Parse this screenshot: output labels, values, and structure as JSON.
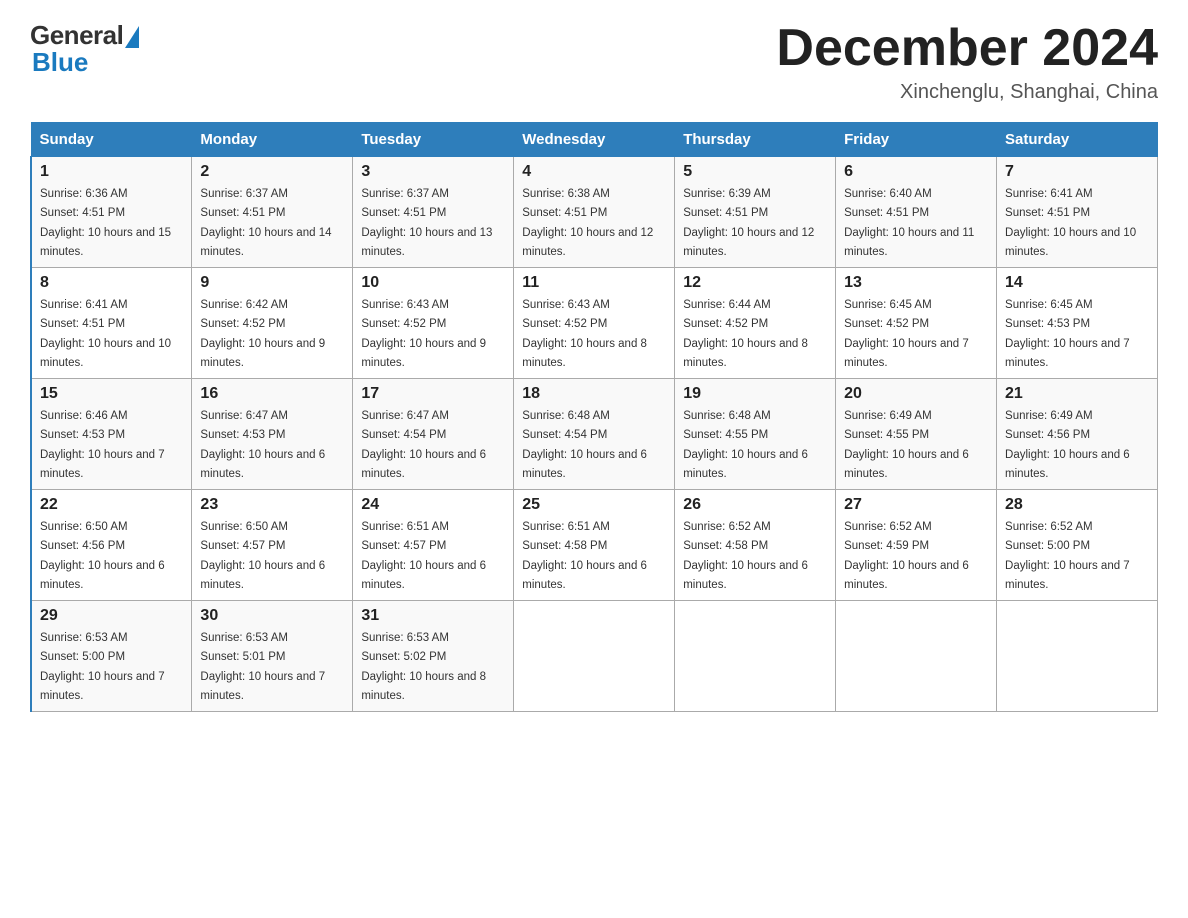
{
  "logo": {
    "general": "General",
    "blue": "Blue"
  },
  "title": "December 2024",
  "location": "Xinchenglu, Shanghai, China",
  "days_of_week": [
    "Sunday",
    "Monday",
    "Tuesday",
    "Wednesday",
    "Thursday",
    "Friday",
    "Saturday"
  ],
  "weeks": [
    [
      {
        "day": "1",
        "sunrise": "6:36 AM",
        "sunset": "4:51 PM",
        "daylight": "10 hours and 15 minutes."
      },
      {
        "day": "2",
        "sunrise": "6:37 AM",
        "sunset": "4:51 PM",
        "daylight": "10 hours and 14 minutes."
      },
      {
        "day": "3",
        "sunrise": "6:37 AM",
        "sunset": "4:51 PM",
        "daylight": "10 hours and 13 minutes."
      },
      {
        "day": "4",
        "sunrise": "6:38 AM",
        "sunset": "4:51 PM",
        "daylight": "10 hours and 12 minutes."
      },
      {
        "day": "5",
        "sunrise": "6:39 AM",
        "sunset": "4:51 PM",
        "daylight": "10 hours and 12 minutes."
      },
      {
        "day": "6",
        "sunrise": "6:40 AM",
        "sunset": "4:51 PM",
        "daylight": "10 hours and 11 minutes."
      },
      {
        "day": "7",
        "sunrise": "6:41 AM",
        "sunset": "4:51 PM",
        "daylight": "10 hours and 10 minutes."
      }
    ],
    [
      {
        "day": "8",
        "sunrise": "6:41 AM",
        "sunset": "4:51 PM",
        "daylight": "10 hours and 10 minutes."
      },
      {
        "day": "9",
        "sunrise": "6:42 AM",
        "sunset": "4:52 PM",
        "daylight": "10 hours and 9 minutes."
      },
      {
        "day": "10",
        "sunrise": "6:43 AM",
        "sunset": "4:52 PM",
        "daylight": "10 hours and 9 minutes."
      },
      {
        "day": "11",
        "sunrise": "6:43 AM",
        "sunset": "4:52 PM",
        "daylight": "10 hours and 8 minutes."
      },
      {
        "day": "12",
        "sunrise": "6:44 AM",
        "sunset": "4:52 PM",
        "daylight": "10 hours and 8 minutes."
      },
      {
        "day": "13",
        "sunrise": "6:45 AM",
        "sunset": "4:52 PM",
        "daylight": "10 hours and 7 minutes."
      },
      {
        "day": "14",
        "sunrise": "6:45 AM",
        "sunset": "4:53 PM",
        "daylight": "10 hours and 7 minutes."
      }
    ],
    [
      {
        "day": "15",
        "sunrise": "6:46 AM",
        "sunset": "4:53 PM",
        "daylight": "10 hours and 7 minutes."
      },
      {
        "day": "16",
        "sunrise": "6:47 AM",
        "sunset": "4:53 PM",
        "daylight": "10 hours and 6 minutes."
      },
      {
        "day": "17",
        "sunrise": "6:47 AM",
        "sunset": "4:54 PM",
        "daylight": "10 hours and 6 minutes."
      },
      {
        "day": "18",
        "sunrise": "6:48 AM",
        "sunset": "4:54 PM",
        "daylight": "10 hours and 6 minutes."
      },
      {
        "day": "19",
        "sunrise": "6:48 AM",
        "sunset": "4:55 PM",
        "daylight": "10 hours and 6 minutes."
      },
      {
        "day": "20",
        "sunrise": "6:49 AM",
        "sunset": "4:55 PM",
        "daylight": "10 hours and 6 minutes."
      },
      {
        "day": "21",
        "sunrise": "6:49 AM",
        "sunset": "4:56 PM",
        "daylight": "10 hours and 6 minutes."
      }
    ],
    [
      {
        "day": "22",
        "sunrise": "6:50 AM",
        "sunset": "4:56 PM",
        "daylight": "10 hours and 6 minutes."
      },
      {
        "day": "23",
        "sunrise": "6:50 AM",
        "sunset": "4:57 PM",
        "daylight": "10 hours and 6 minutes."
      },
      {
        "day": "24",
        "sunrise": "6:51 AM",
        "sunset": "4:57 PM",
        "daylight": "10 hours and 6 minutes."
      },
      {
        "day": "25",
        "sunrise": "6:51 AM",
        "sunset": "4:58 PM",
        "daylight": "10 hours and 6 minutes."
      },
      {
        "day": "26",
        "sunrise": "6:52 AM",
        "sunset": "4:58 PM",
        "daylight": "10 hours and 6 minutes."
      },
      {
        "day": "27",
        "sunrise": "6:52 AM",
        "sunset": "4:59 PM",
        "daylight": "10 hours and 6 minutes."
      },
      {
        "day": "28",
        "sunrise": "6:52 AM",
        "sunset": "5:00 PM",
        "daylight": "10 hours and 7 minutes."
      }
    ],
    [
      {
        "day": "29",
        "sunrise": "6:53 AM",
        "sunset": "5:00 PM",
        "daylight": "10 hours and 7 minutes."
      },
      {
        "day": "30",
        "sunrise": "6:53 AM",
        "sunset": "5:01 PM",
        "daylight": "10 hours and 7 minutes."
      },
      {
        "day": "31",
        "sunrise": "6:53 AM",
        "sunset": "5:02 PM",
        "daylight": "10 hours and 8 minutes."
      },
      null,
      null,
      null,
      null
    ]
  ]
}
